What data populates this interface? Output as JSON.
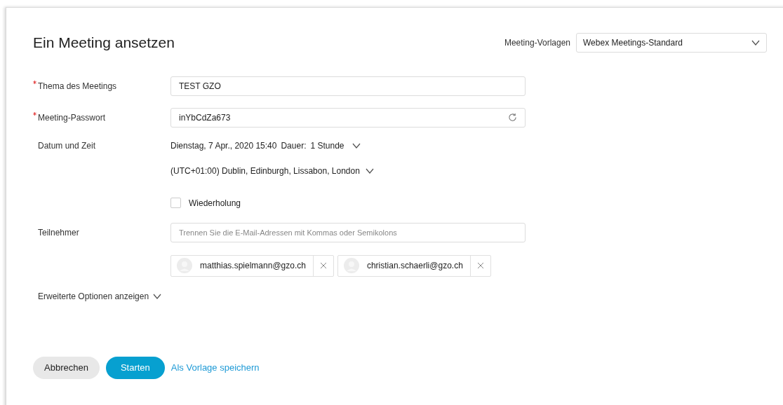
{
  "title": "Ein Meeting ansetzen",
  "template": {
    "label": "Meeting-Vorlagen",
    "value": "Webex Meetings-Standard"
  },
  "topic": {
    "label": "Thema des Meetings",
    "required": true,
    "value": "TEST GZO"
  },
  "password": {
    "label": "Meeting-Passwort",
    "required": true,
    "value": "inYbCdZa673"
  },
  "datetime": {
    "label": "Datum und Zeit",
    "date": "Dienstag, 7 Apr., 2020 15:40",
    "duration_label": "Dauer:",
    "duration": "1 Stunde",
    "timezone": "(UTC+01:00) Dublin, Edinburgh, Lissabon, London"
  },
  "recurrence": {
    "label": "Wiederholung",
    "checked": false
  },
  "attendees": {
    "label": "Teilnehmer",
    "placeholder": "Trennen Sie die E-Mail-Adressen mit Kommas oder Semikolons",
    "chips": [
      {
        "email": "matthias.spielmann@gzo.ch"
      },
      {
        "email": "christian.schaerli@gzo.ch"
      }
    ]
  },
  "advanced": {
    "label": "Erweiterte Optionen anzeigen",
    "expanded": false
  },
  "buttons": [
    {
      "kind": "secondary",
      "label": "Abbrechen"
    },
    {
      "kind": "primary",
      "label": "Starten"
    },
    {
      "kind": "link",
      "label": "Als Vorlage speichern"
    }
  ]
}
